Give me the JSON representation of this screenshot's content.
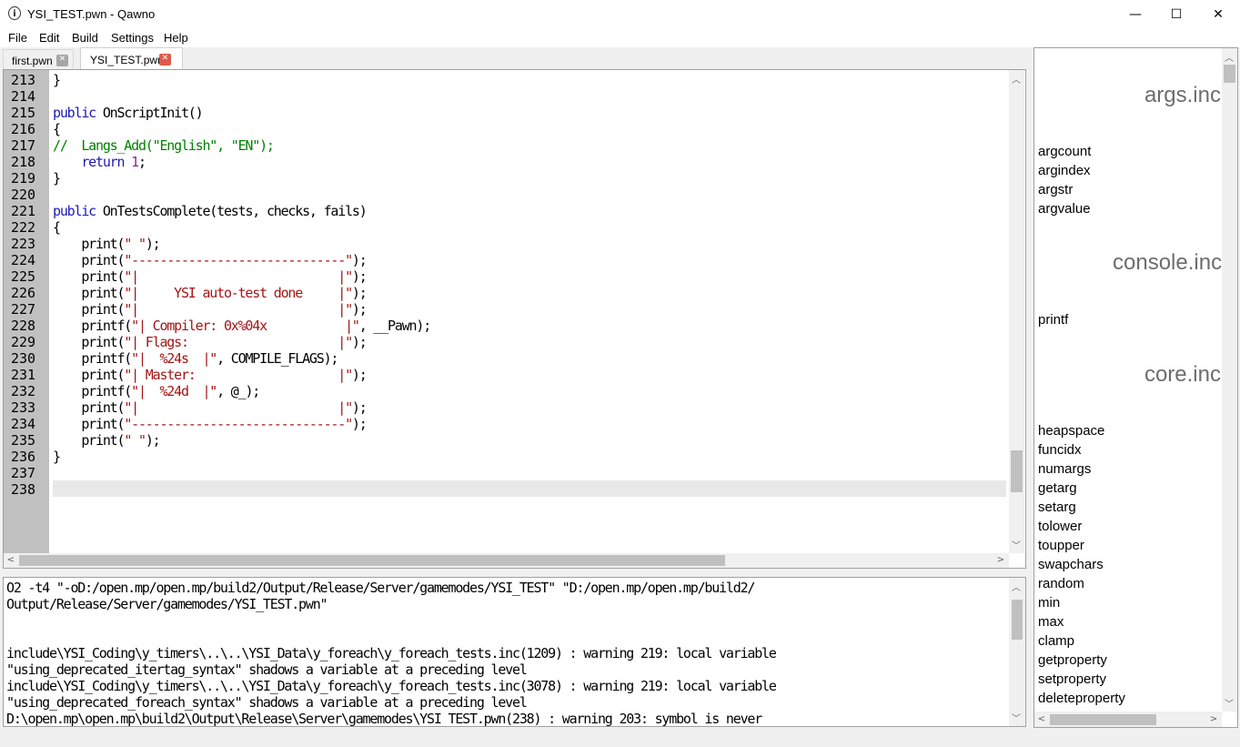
{
  "window": {
    "title": "YSI_TEST.pwn - Qawno",
    "icon": "qawno-app-icon",
    "controls": {
      "minimize": "—",
      "maximize": "☐",
      "close": "✕"
    }
  },
  "menu": [
    "File",
    "Edit",
    "Build",
    "Settings",
    "Help"
  ],
  "tabs": [
    {
      "label": "first.pwn",
      "close": "✕"
    },
    {
      "label": "YSI_TEST.pwn",
      "close": "✕"
    }
  ],
  "editor": {
    "line_numbers": [
      "213",
      "214",
      "215",
      "216",
      "217",
      "218",
      "219",
      "220",
      "221",
      "222",
      "223",
      "224",
      "225",
      "226",
      "227",
      "228",
      "229",
      "230",
      "231",
      "232",
      "233",
      "234",
      "235",
      "236",
      "237",
      "238"
    ],
    "lines": [
      "}",
      "",
      "public OnScriptInit()",
      "{",
      "//  Langs_Add(\"English\", \"EN\");",
      "    return 1;",
      "}",
      "",
      "public OnTestsComplete(tests, checks, fails)",
      "{",
      "    print(\" \");",
      "    print(\"------------------------------\");",
      "    print(\"|                            |\");",
      "    print(\"|     YSI auto-test done     |\");",
      "    print(\"|                            |\");",
      "    printf(\"| Compiler: 0x%04x           |\", __Pawn);",
      "    print(\"| Flags:                     |\");",
      "    printf(\"|  %24s  |\", COMPILE_FLAGS);",
      "    print(\"| Master:                    |\");",
      "    printf(\"|  %24d  |\", @_);",
      "    print(\"|                            |\");",
      "    print(\"------------------------------\");",
      "    print(\" \");",
      "}",
      "",
      ""
    ]
  },
  "output": {
    "lines": [
      "O2 -t4 \"-oD:/open.mp/open.mp/build2/Output/Release/Server/gamemodes/YSI_TEST\" \"D:/open.mp/open.mp/build2/",
      "Output/Release/Server/gamemodes/YSI_TEST.pwn\"",
      "",
      "",
      "include\\YSI_Coding\\y_timers\\..\\..\\YSI_Data\\y_foreach\\y_foreach_tests.inc(1209) : warning 219: local variable",
      "\"using_deprecated_itertag_syntax\" shadows a variable at a preceding level",
      "include\\YSI_Coding\\y_timers\\..\\..\\YSI_Data\\y_foreach\\y_foreach_tests.inc(3078) : warning 219: local variable",
      "\"using_deprecated_foreach_syntax\" shadows a variable at a preceding level",
      "D:\\open.mp\\open.mp\\build2\\Output\\Release\\Server\\gamemodes\\YSI_TEST.pwn(238) : warning 203: symbol is never"
    ]
  },
  "sidebar": {
    "groups": [
      {
        "header": "args.inc",
        "functions": [
          "argcount",
          "argindex",
          "argstr",
          "argvalue"
        ]
      },
      {
        "header": "console.inc",
        "functions": [
          "printf"
        ]
      },
      {
        "header": "core.inc",
        "functions": [
          "heapspace",
          "funcidx",
          "numargs",
          "getarg",
          "setarg",
          "tolower",
          "toupper",
          "swapchars",
          "random",
          "min",
          "max",
          "clamp",
          "getproperty",
          "setproperty",
          "deleteproperty"
        ]
      }
    ]
  },
  "colors": {
    "keyword": "#1a1ab4",
    "string": "#a31515",
    "number": "#8a2b8a",
    "comment": "#008000",
    "gutter": "#c0c0c0",
    "tab_close": "#e0594a"
  }
}
